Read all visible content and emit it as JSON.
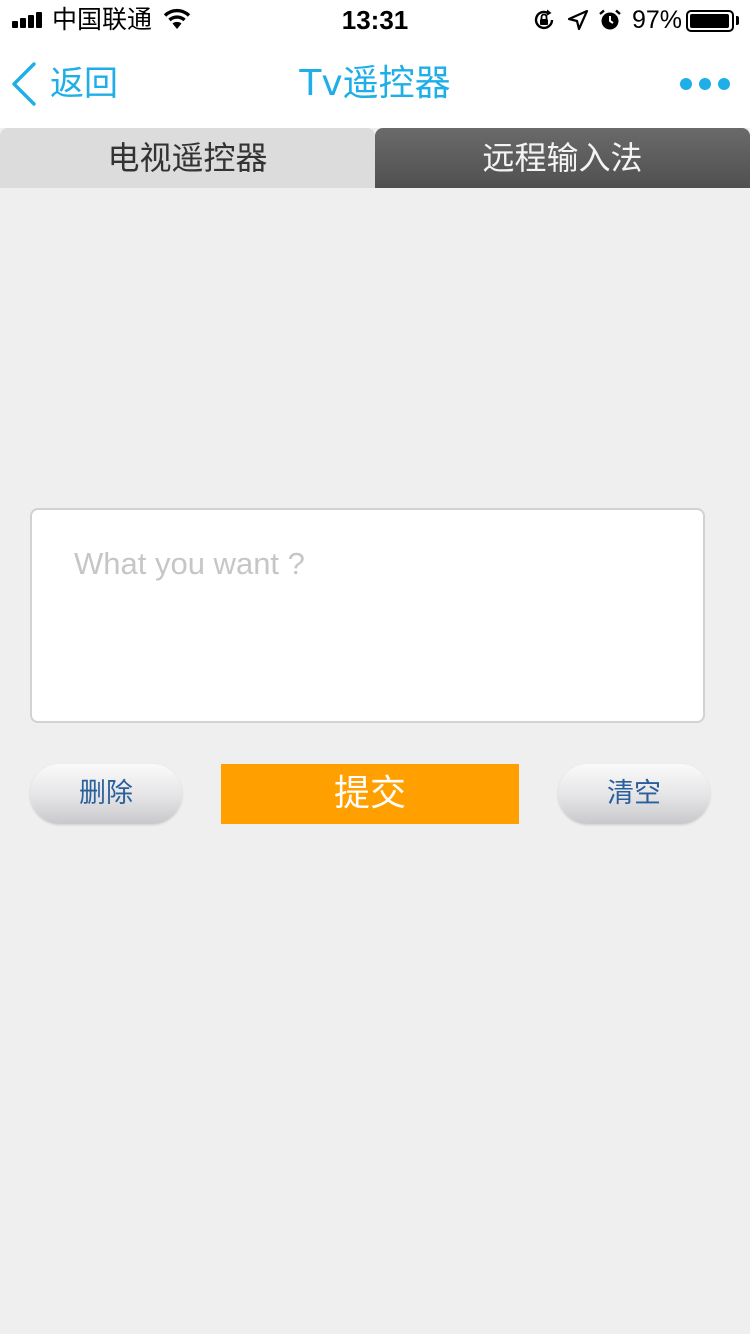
{
  "status_bar": {
    "carrier": "中国联通",
    "time": "13:31",
    "battery_percent": "97%",
    "battery_level": 0.97,
    "icons": [
      "signal-icon",
      "wifi-icon",
      "orientation-lock-icon",
      "location-arrow-icon",
      "alarm-icon",
      "battery-icon"
    ]
  },
  "nav": {
    "back_label": "返回",
    "title": "Tv遥控器",
    "more_icon": "more-dots-icon",
    "accent_color": "#1eaee8"
  },
  "tabs": [
    {
      "label": "电视遥控器",
      "active": false
    },
    {
      "label": "远程输入法",
      "active": true
    }
  ],
  "input": {
    "placeholder": "What you want ?",
    "value": ""
  },
  "actions": {
    "delete_label": "删除",
    "submit_label": "提交",
    "clear_label": "清空",
    "submit_color": "#ff9f00"
  }
}
